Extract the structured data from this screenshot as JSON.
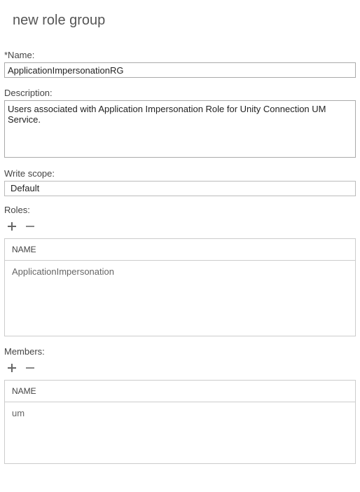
{
  "page": {
    "title": "new role group"
  },
  "fields": {
    "name": {
      "label": "*Name:",
      "value": "ApplicationImpersonationRG"
    },
    "description": {
      "label": "Description:",
      "value": "Users associated with Application Impersonation Role for Unity Connection UM Service."
    },
    "writeScope": {
      "label": "Write scope:",
      "value": "Default"
    },
    "roles": {
      "label": "Roles:",
      "columnHeader": "NAME",
      "items": [
        {
          "name": "ApplicationImpersonation"
        }
      ]
    },
    "members": {
      "label": "Members:",
      "columnHeader": "NAME",
      "items": [
        {
          "name": "um"
        }
      ]
    }
  }
}
